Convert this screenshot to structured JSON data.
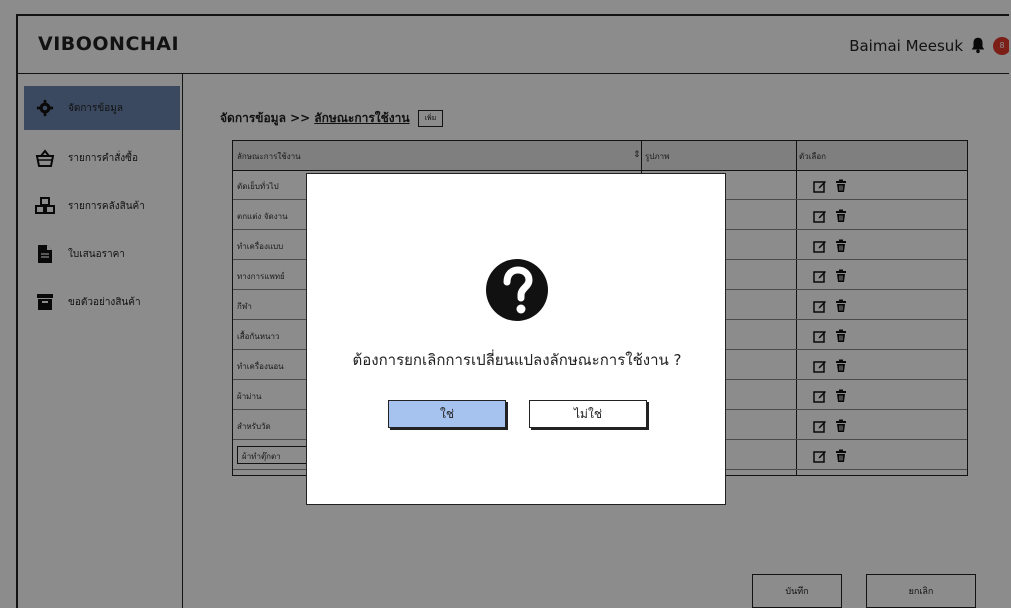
{
  "header": {
    "logo": "VIBOONCHAI",
    "user_name": "Baimai Meesuk",
    "notification_count": "8"
  },
  "sidebar": {
    "items": [
      {
        "label": "จัดการข้อมูล",
        "icon": "gear-icon",
        "active": true
      },
      {
        "label": "รายการคำสั่งซื้อ",
        "icon": "basket-icon",
        "active": false
      },
      {
        "label": "รายการคลังสินค้า",
        "icon": "boxes-icon",
        "active": false
      },
      {
        "label": "ใบเสนอราคา",
        "icon": "document-icon",
        "active": false
      },
      {
        "label": "ขอตัวอย่างสินค้า",
        "icon": "archive-icon",
        "active": false
      }
    ]
  },
  "main": {
    "breadcrumb": {
      "root": "จัดการข้อมูล >>",
      "current": "ลักษณะการใช้งาน",
      "add_label": "เพิ่ม"
    },
    "table": {
      "headers": [
        "ลักษณะการใช้งาน",
        "รูปภาพ",
        "ตัวเลือก"
      ],
      "sort_icon": "sort-icon",
      "rows": [
        {
          "name": "ตัดเย็บทั่วไป"
        },
        {
          "name": "ตกแต่ง จัดงาน"
        },
        {
          "name": "ทำเครื่องแบบ"
        },
        {
          "name": "ทางการแพทย์"
        },
        {
          "name": "กีฬา"
        },
        {
          "name": "เสื้อกันหนาว"
        },
        {
          "name": "ทำเครื่องนอน"
        },
        {
          "name": "ผ้าม่าน"
        },
        {
          "name": "สำหรับวัด"
        }
      ],
      "input_row_value": "ผ้าทำตุ๊กตา"
    },
    "save_label": "บันทึก",
    "cancel_label": "ยกเลิก"
  },
  "modal": {
    "icon": "question-icon",
    "message": "ต้องการยกเลิกการเปลี่ยนแปลงลักษณะการใช้งาน ?",
    "yes_label": "ใช่",
    "no_label": "ไม่ใช่"
  },
  "colors": {
    "active_sidebar": "#6a86ad",
    "yes_button": "#a6c3ef",
    "notification": "#e0392b"
  }
}
